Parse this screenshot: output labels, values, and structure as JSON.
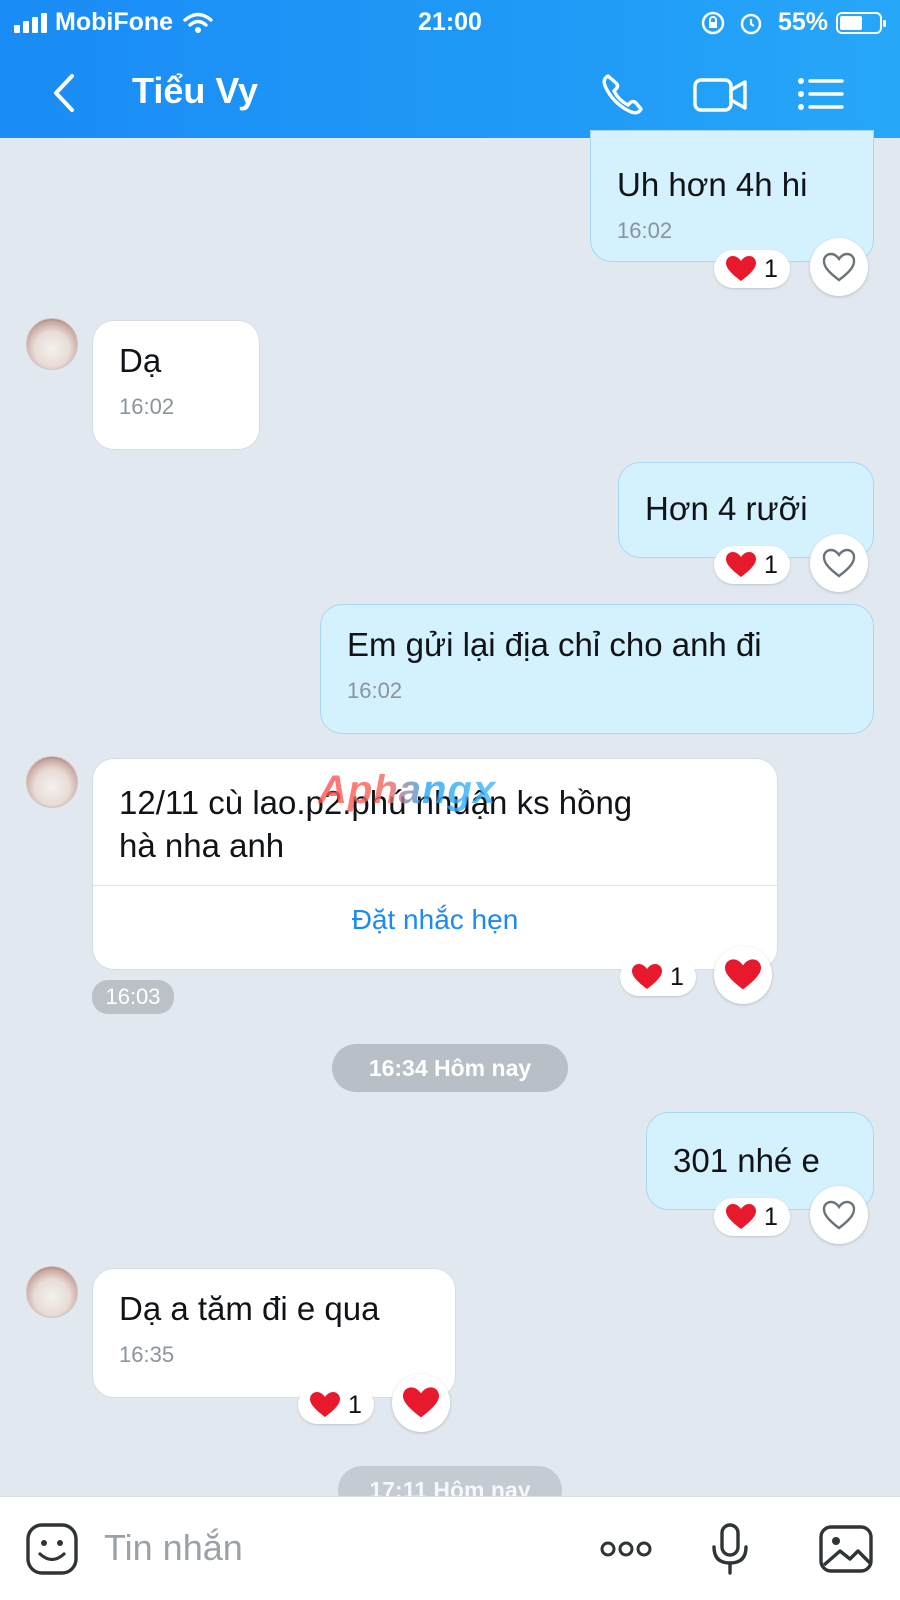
{
  "status_bar": {
    "carrier": "MobiFone",
    "time": "21:00",
    "battery": "55%"
  },
  "header": {
    "title": "Tiểu Vy"
  },
  "messages": [
    {
      "text": "Uh hơn 4h hi",
      "time": "16:02",
      "reaction_count": "1"
    },
    {
      "text": "Dạ",
      "time": "16:02"
    },
    {
      "text": "Hơn 4 rưỡi",
      "reaction_count": "1"
    },
    {
      "text": "Em gửi lại địa chỉ cho anh đi",
      "time": "16:02"
    },
    {
      "text_line1": "12/11 cù lao.p2.phú nhuận ks hồng",
      "text_line2": "hà  nha anh",
      "action": "Đặt nhắc hẹn",
      "time": "16:03",
      "reaction_count": "1"
    },
    {
      "text": "301 nhé e",
      "reaction_count": "1"
    },
    {
      "text": "Dạ a tăm đi e qua",
      "time": "16:35",
      "reaction_count": "1"
    }
  ],
  "separators": [
    "16:34 Hôm nay",
    "17:11 Hôm nay"
  ],
  "watermark": "Aphangx",
  "composer": {
    "placeholder": "Tin nhắn"
  },
  "colors": {
    "header": "#1a8cf5",
    "outgoing_bubble": "#d4f1fe",
    "incoming_bubble": "#ffffff",
    "heart": "#e8192c",
    "link": "#1b8af2"
  }
}
